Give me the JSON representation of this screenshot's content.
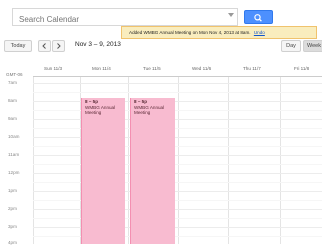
{
  "search": {
    "placeholder": "Search Calendar"
  },
  "notification": {
    "message": "Added WMBG Annual Meeting on Mon Nov 4, 2013 at 8am.",
    "undo_label": "Undo"
  },
  "toolbar": {
    "today_label": "Today",
    "prev_icon": "chevron-left-icon",
    "next_icon": "chevron-right-icon",
    "date_range": "Nov 3 – 9, 2013",
    "day_label": "Day",
    "week_label": "Week"
  },
  "timezone_label": "GMT-06",
  "day_headers": [
    "Sun 11/3",
    "Mon 11/4",
    "Tue 11/5",
    "Wed 11/6",
    "Thu 11/7",
    "Fri 11/8"
  ],
  "time_labels": [
    "7am",
    "8am",
    "9am",
    "10am",
    "11am",
    "12pm",
    "1pm",
    "2pm",
    "3pm",
    "4pm"
  ],
  "events": [
    {
      "day": "Mon 11/4",
      "time": "8 – 5p",
      "title": "WMBG Annual Meeting",
      "color": "#f8bbd0"
    },
    {
      "day": "Tue 11/5",
      "time": "8 – 5p",
      "title": "WMBG Annual Meeting",
      "color": "#f8bbd0"
    }
  ],
  "colors": {
    "accent": "#4d90fe",
    "notice_bg": "#f9edbe",
    "event": "#f8bbd0"
  }
}
